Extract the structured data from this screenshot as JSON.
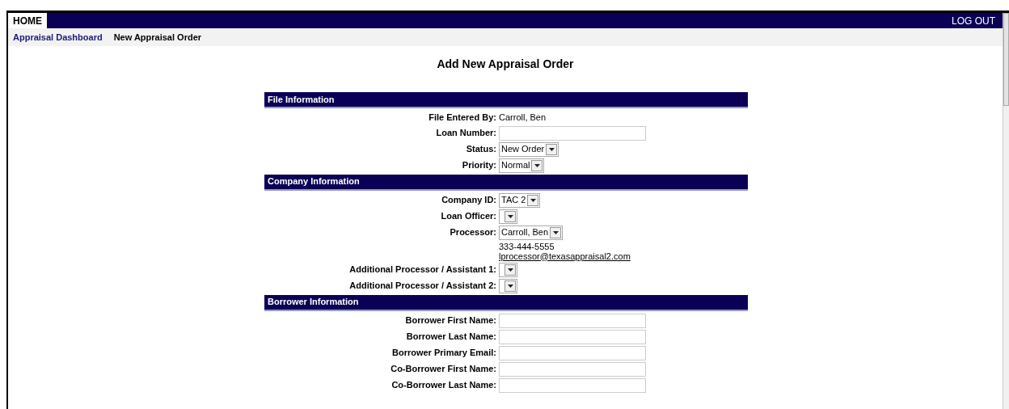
{
  "nav": {
    "home": "HOME",
    "logout": "LOG OUT"
  },
  "breadcrumbs": [
    {
      "label": "Appraisal Dashboard",
      "selected": false
    },
    {
      "label": "New Appraisal Order",
      "selected": true
    }
  ],
  "title": "Add New Appraisal Order",
  "sections": [
    {
      "title": "File Information",
      "fields": [
        {
          "kind": "text",
          "label": "File Entered By:",
          "value": "Carroll, Ben"
        },
        {
          "kind": "input",
          "label": "Loan Number:"
        },
        {
          "kind": "select",
          "label": "Status:",
          "value": "New Order"
        },
        {
          "kind": "select",
          "label": "Priority:",
          "value": "Normal"
        }
      ]
    },
    {
      "title": "Company Information",
      "fields": [
        {
          "kind": "select",
          "label": "Company ID:",
          "value": "TAC 2"
        },
        {
          "kind": "select",
          "label": "Loan Officer:"
        },
        {
          "kind": "select",
          "label": "Processor:",
          "value": "Carroll, Ben"
        },
        {
          "kind": "contact",
          "phone": "333-444-5555",
          "email": "lprocessor@texasappraisal2.com"
        },
        {
          "kind": "select",
          "label": "Additional Processor / Assistant 1:"
        },
        {
          "kind": "select",
          "label": "Additional Processor / Assistant 2:"
        }
      ]
    },
    {
      "title": "Borrower Information",
      "fields": [
        {
          "kind": "input",
          "label": "Borrower First Name:"
        },
        {
          "kind": "input",
          "label": "Borrower Last Name:"
        },
        {
          "kind": "input",
          "label": "Borrower Primary Email:"
        },
        {
          "kind": "input",
          "label": "Co-Borrower First Name:"
        },
        {
          "kind": "input",
          "label": "Co-Borrower Last Name:"
        }
      ]
    }
  ]
}
